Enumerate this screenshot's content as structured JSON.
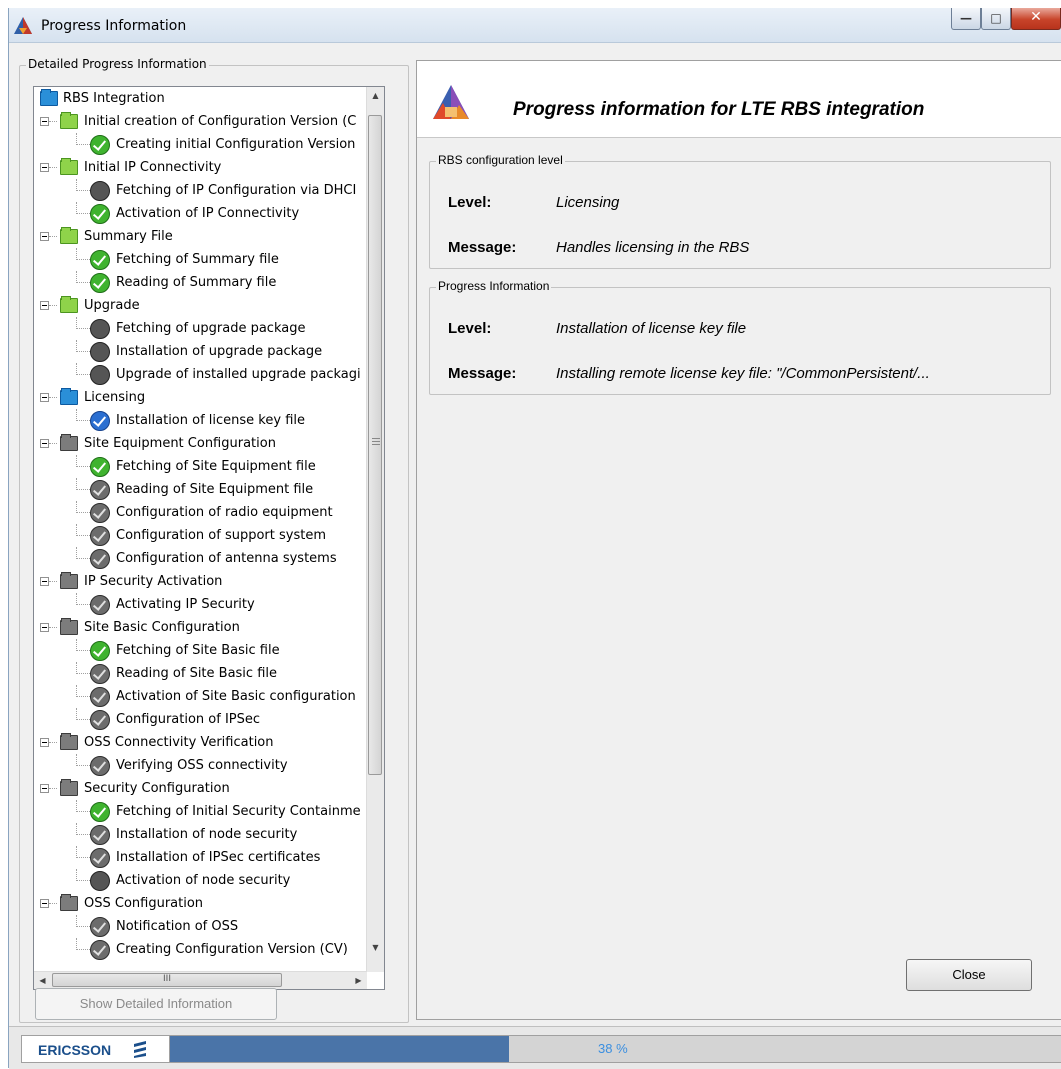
{
  "window": {
    "title": "Progress Information"
  },
  "detail_group": {
    "legend": "Detailed Progress Information"
  },
  "tree": [
    {
      "label": "RBS Integration",
      "kind": "folder",
      "color": "blue",
      "level": 0
    },
    {
      "label": "Initial creation of Configuration Version (C",
      "kind": "folder",
      "color": "green",
      "level": 1
    },
    {
      "label": "Creating initial Configuration Version",
      "kind": "step",
      "status": "done",
      "level": 2
    },
    {
      "label": "Initial IP Connectivity",
      "kind": "folder",
      "color": "green",
      "level": 1
    },
    {
      "label": "Fetching of IP Configuration via DHCI",
      "kind": "step",
      "status": "stop",
      "level": 2
    },
    {
      "label": "Activation of IP Connectivity",
      "kind": "step",
      "status": "done",
      "level": 2
    },
    {
      "label": "Summary File",
      "kind": "folder",
      "color": "green",
      "level": 1
    },
    {
      "label": "Fetching of Summary file",
      "kind": "step",
      "status": "done",
      "level": 2
    },
    {
      "label": "Reading of Summary file",
      "kind": "step",
      "status": "done",
      "level": 2
    },
    {
      "label": "Upgrade",
      "kind": "folder",
      "color": "green",
      "level": 1
    },
    {
      "label": "Fetching of upgrade package",
      "kind": "step",
      "status": "stop",
      "level": 2
    },
    {
      "label": "Installation of upgrade package",
      "kind": "step",
      "status": "stop",
      "level": 2
    },
    {
      "label": "Upgrade of installed upgrade packagi",
      "kind": "step",
      "status": "stop",
      "level": 2
    },
    {
      "label": "Licensing",
      "kind": "folder",
      "color": "blue",
      "level": 1
    },
    {
      "label": "Installation of license key file",
      "kind": "step",
      "status": "active",
      "level": 2
    },
    {
      "label": "Site Equipment Configuration",
      "kind": "folder",
      "color": "grey",
      "level": 1
    },
    {
      "label": "Fetching of Site Equipment file",
      "kind": "step",
      "status": "done",
      "level": 2
    },
    {
      "label": "Reading of Site Equipment file",
      "kind": "step",
      "status": "pending",
      "level": 2
    },
    {
      "label": "Configuration of radio equipment",
      "kind": "step",
      "status": "pending",
      "level": 2
    },
    {
      "label": "Configuration of support system",
      "kind": "step",
      "status": "pending",
      "level": 2
    },
    {
      "label": "Configuration of antenna systems",
      "kind": "step",
      "status": "pending",
      "level": 2
    },
    {
      "label": "IP Security Activation",
      "kind": "folder",
      "color": "grey",
      "level": 1
    },
    {
      "label": "Activating IP Security",
      "kind": "step",
      "status": "pending",
      "level": 2
    },
    {
      "label": "Site Basic Configuration",
      "kind": "folder",
      "color": "grey",
      "level": 1
    },
    {
      "label": "Fetching of Site Basic file",
      "kind": "step",
      "status": "done",
      "level": 2
    },
    {
      "label": "Reading of Site Basic file",
      "kind": "step",
      "status": "pending",
      "level": 2
    },
    {
      "label": "Activation of Site Basic configuration",
      "kind": "step",
      "status": "pending",
      "level": 2
    },
    {
      "label": "Configuration of IPSec",
      "kind": "step",
      "status": "pending",
      "level": 2
    },
    {
      "label": "OSS Connectivity Verification",
      "kind": "folder",
      "color": "grey",
      "level": 1
    },
    {
      "label": "Verifying OSS connectivity",
      "kind": "step",
      "status": "pending",
      "level": 2
    },
    {
      "label": "Security Configuration",
      "kind": "folder",
      "color": "grey",
      "level": 1
    },
    {
      "label": "Fetching of Initial Security Containme",
      "kind": "step",
      "status": "done",
      "level": 2
    },
    {
      "label": "Installation of node security",
      "kind": "step",
      "status": "pending",
      "level": 2
    },
    {
      "label": "Installation of IPSec certificates",
      "kind": "step",
      "status": "pending",
      "level": 2
    },
    {
      "label": "Activation of node security",
      "kind": "step",
      "status": "stop",
      "level": 2
    },
    {
      "label": "OSS Configuration",
      "kind": "folder",
      "color": "grey",
      "level": 1
    },
    {
      "label": "Notification of OSS",
      "kind": "step",
      "status": "pending",
      "level": 2
    },
    {
      "label": "Creating Configuration Version (CV)",
      "kind": "step",
      "status": "pending",
      "level": 2
    }
  ],
  "hscroll_thumb_label": "III",
  "show_detail_button": "Show Detailed Information",
  "header": {
    "title": "Progress information for LTE RBS integration"
  },
  "config_group": {
    "legend": "RBS configuration level",
    "level_label": "Level:",
    "level_value": "Licensing",
    "message_label": "Message:",
    "message_value": "Handles licensing in the RBS"
  },
  "progress_group": {
    "legend": "Progress Information",
    "level_label": "Level:",
    "level_value": "Installation of license key file",
    "message_label": "Message:",
    "message_value": "Installing remote license key file: \"/CommonPersistent/..."
  },
  "close_button": "Close",
  "statusbar": {
    "brand": "ERICSSON",
    "progress_percent": 38,
    "progress_text": "38 %"
  }
}
